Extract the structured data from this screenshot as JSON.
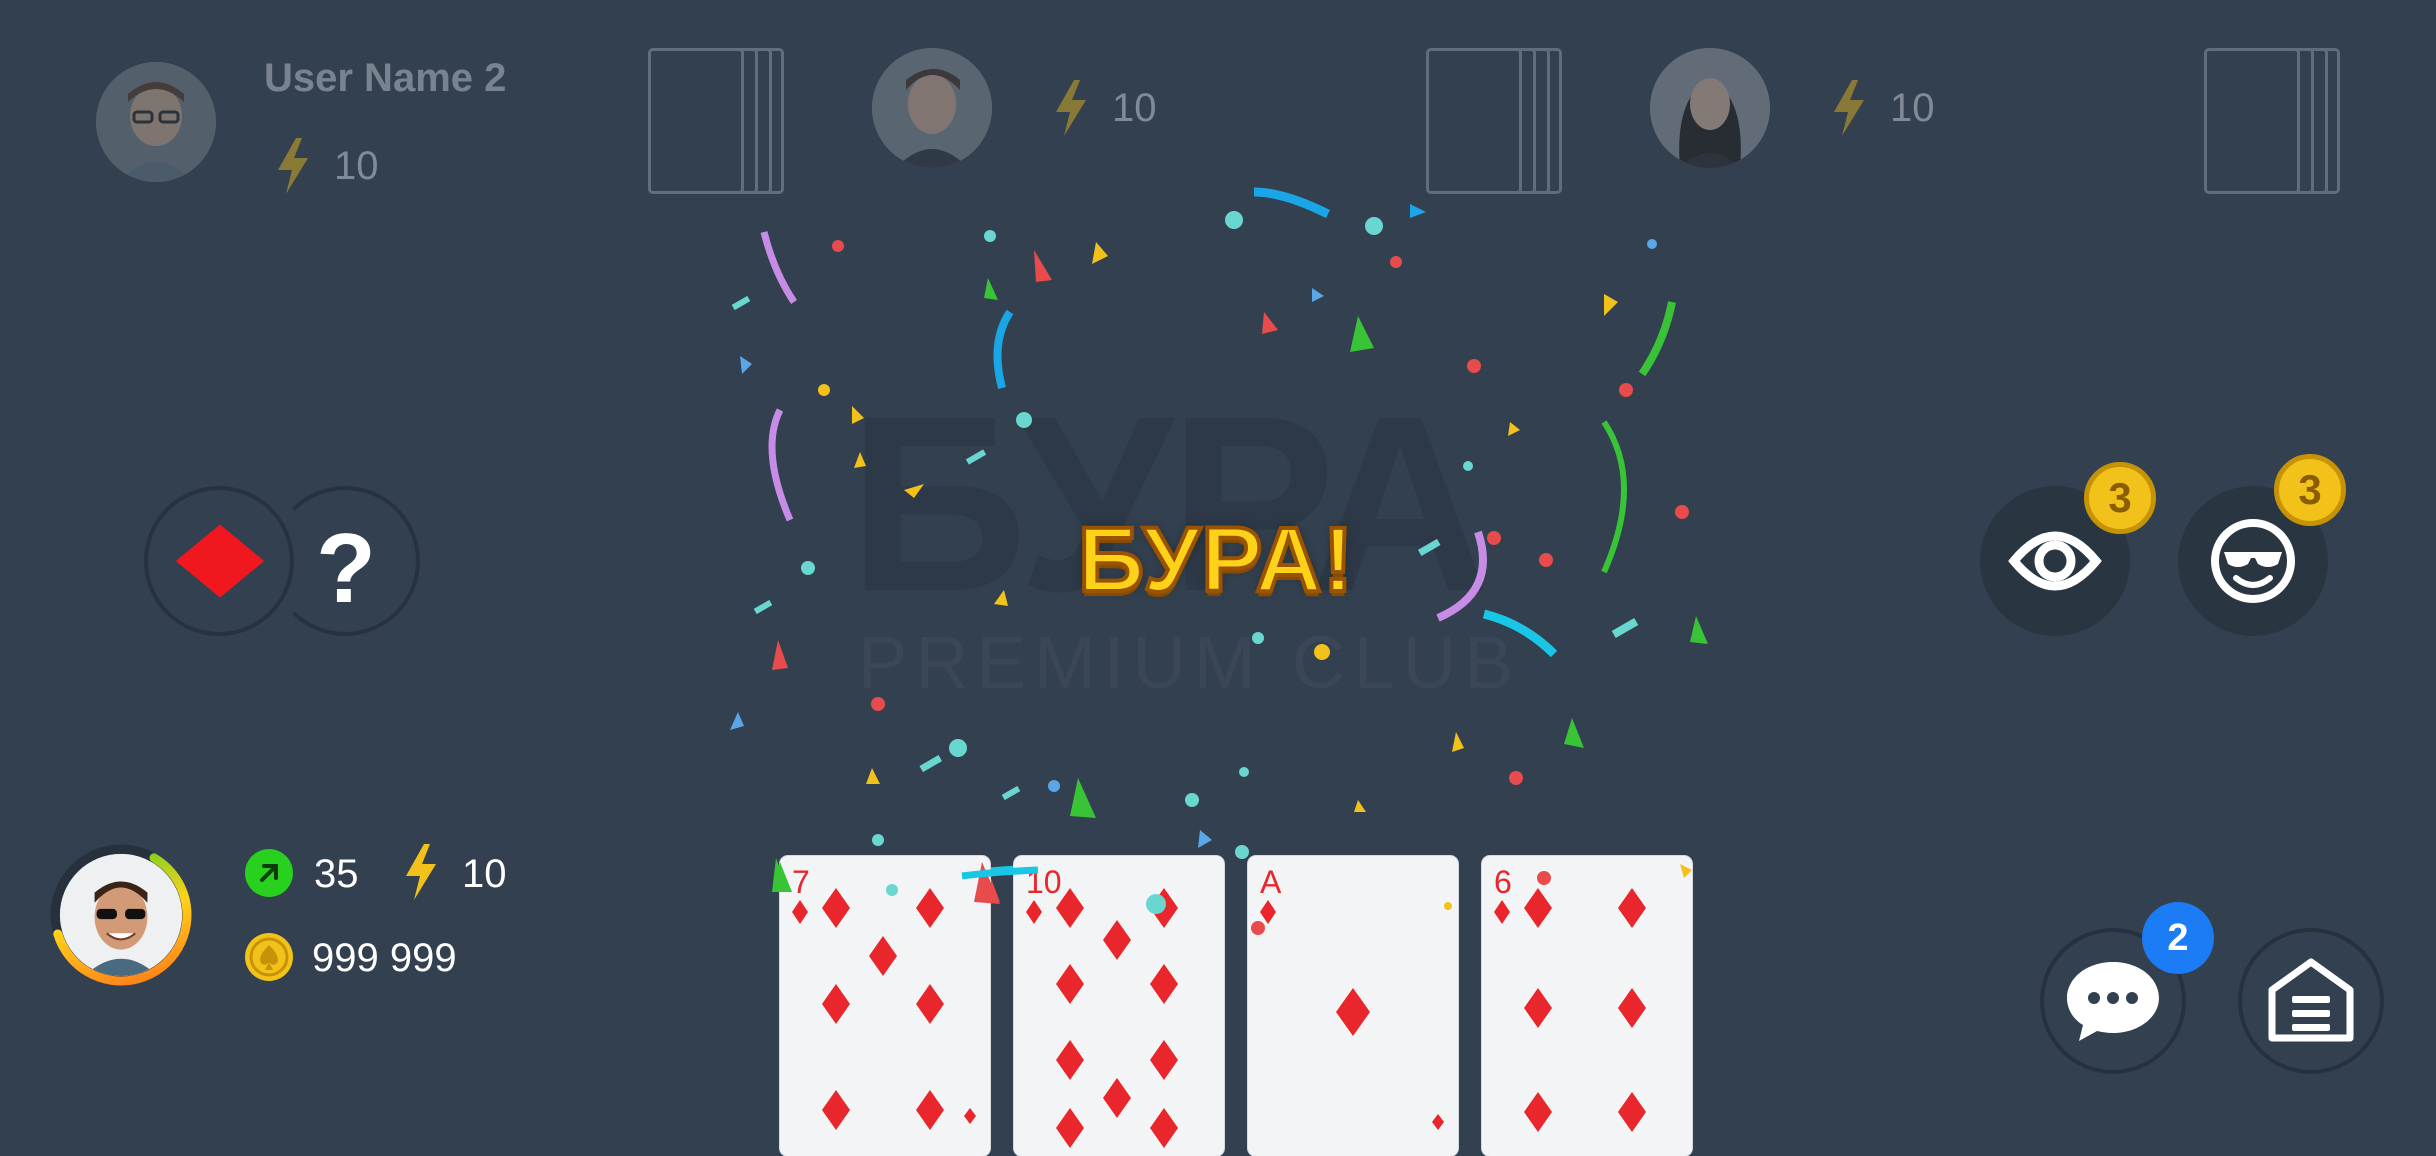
{
  "opponents": [
    {
      "name": "User Name 2",
      "energy": "10",
      "avatar": "avatar-glasses-man"
    },
    {
      "name": "",
      "energy": "10",
      "avatar": "avatar-young-man"
    },
    {
      "name": "",
      "energy": "10",
      "avatar": "avatar-woman"
    }
  ],
  "watermark": {
    "title": "БУРА",
    "subtitle": "PREMIUM CLUB"
  },
  "announcement": "БУРА!",
  "trump": {
    "suit": "diamond-icon",
    "unknown_label": "?"
  },
  "actions": [
    {
      "icon": "eye-icon",
      "count": "3"
    },
    {
      "icon": "sunglasses-face-icon",
      "count": "3"
    }
  ],
  "player": {
    "level": "35",
    "energy": "10",
    "coins": "999 999",
    "progress": 0.62
  },
  "hand": [
    {
      "rank": "7",
      "suit": "diamonds"
    },
    {
      "rank": "10",
      "suit": "diamonds"
    },
    {
      "rank": "A",
      "suit": "diamonds"
    },
    {
      "rank": "6",
      "suit": "diamonds"
    }
  ],
  "chat": {
    "icon": "chat-bubble-icon",
    "unread": "2"
  },
  "menu": {
    "icon": "menu-house-icon"
  },
  "colors": {
    "background": "#33404f",
    "accent_gold": "#ffd21a",
    "suit_red": "#e8262b",
    "badge_blue": "#1b7cf5",
    "level_green": "#29d11f"
  }
}
